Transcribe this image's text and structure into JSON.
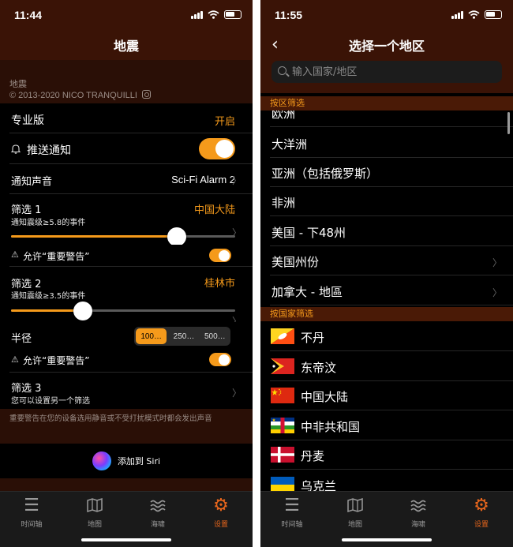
{
  "left": {
    "status_time": "11:44",
    "title": "地震",
    "about": {
      "app": "地震",
      "copyright": "© 2013-2020 NICO TRANQUILLI"
    },
    "pro": {
      "label": "专业版",
      "value": "开启"
    },
    "push": {
      "label": "推送通知",
      "on": true
    },
    "sound": {
      "label": "通知声音",
      "value": "Sci-Fi Alarm 2"
    },
    "filter1": {
      "label": "筛选 1",
      "region": "中国大陆",
      "desc": "通知震级≥5.8的事件",
      "slider_fraction": 0.74,
      "critical_label": "允许“重要警告”",
      "critical_on": true
    },
    "filter2": {
      "label": "筛选 2",
      "region": "桂林市",
      "desc": "通知震级≥3.5的事件",
      "slider_fraction": 0.32
    },
    "radius": {
      "label": "半径",
      "options": [
        "100…",
        "250…",
        "500…"
      ],
      "selected": 0
    },
    "filter2_critical": {
      "label": "允许“重要警告”",
      "on": true
    },
    "filter3": {
      "label": "筛选 3",
      "desc": "您可以设置另一个筛选"
    },
    "footnote": "重要警告在您的设备选用静音或不受打扰模式时都会发出声音",
    "siri": "添加到 Siri"
  },
  "right": {
    "status_time": "11:55",
    "title": "选择一个地区",
    "search_placeholder": "输入国家/地区",
    "section_region": "按区筛选",
    "regions": [
      "欧洲",
      "大洋洲",
      "亚洲（包括俄罗斯）",
      "非洲",
      "美国 - 下48州",
      "美国州份",
      "加拿大 - 地區"
    ],
    "section_country": "按国家筛选",
    "countries": [
      "不丹",
      "东帝汶",
      "中国大陆",
      "中非共和国",
      "丹麦",
      "乌克兰"
    ]
  },
  "tabs": [
    {
      "label": "时间轴",
      "icon": "list-icon"
    },
    {
      "label": "地图",
      "icon": "map-icon"
    },
    {
      "label": "海啸",
      "icon": "waves-icon"
    },
    {
      "label": "设置",
      "icon": "gear-icon",
      "active": true
    }
  ],
  "colors": {
    "accent": "#f59a1b",
    "header": "#3a1306",
    "section": "#4a1a06",
    "tab_active": "#e8661c"
  }
}
